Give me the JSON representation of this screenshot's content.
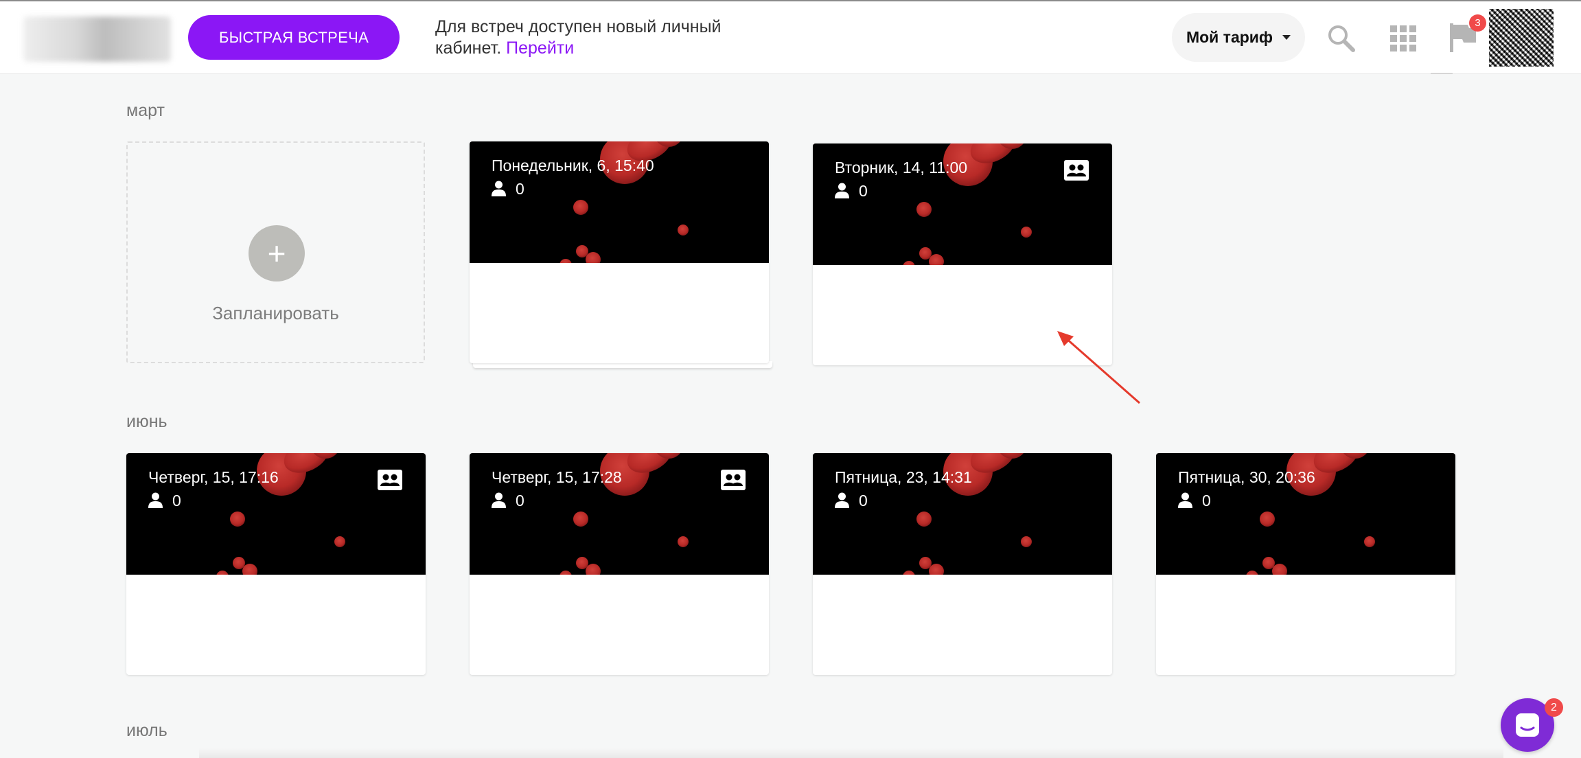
{
  "header": {
    "quick_meeting_label": "БЫСТРАЯ ВСТРЕЧА",
    "notice_text": "Для встреч доступен новый личный кабинет.",
    "notice_link": "Перейти",
    "tariff_label": "Мой тариф",
    "notifications_count": "3",
    "icons": [
      "search-icon",
      "apps-grid-icon",
      "flag-icon"
    ]
  },
  "sections": [
    {
      "month": "март",
      "schedule_label": "Запланировать",
      "meetings": [
        {
          "date": "Понедельник, 6, 15:40",
          "participants": "0",
          "has_contact_icon": false
        },
        {
          "date": "Вторник, 14, 11:00",
          "participants": "0",
          "has_contact_icon": true
        }
      ]
    },
    {
      "month": "июнь",
      "meetings": [
        {
          "date": "Четверг, 15, 17:16",
          "participants": "0",
          "has_contact_icon": true
        },
        {
          "date": "Четверг, 15, 17:28",
          "participants": "0",
          "has_contact_icon": true
        },
        {
          "date": "Пятница, 23, 14:31",
          "participants": "0",
          "has_contact_icon": false
        },
        {
          "date": "Пятница, 30, 20:36",
          "participants": "0",
          "has_contact_icon": false
        }
      ]
    },
    {
      "month": "июль",
      "meetings": []
    }
  ],
  "chat": {
    "unread_count": "2"
  },
  "colors": {
    "accent": "#8b17f5",
    "badge": "#f04a4a",
    "blob": "#c6262a"
  }
}
